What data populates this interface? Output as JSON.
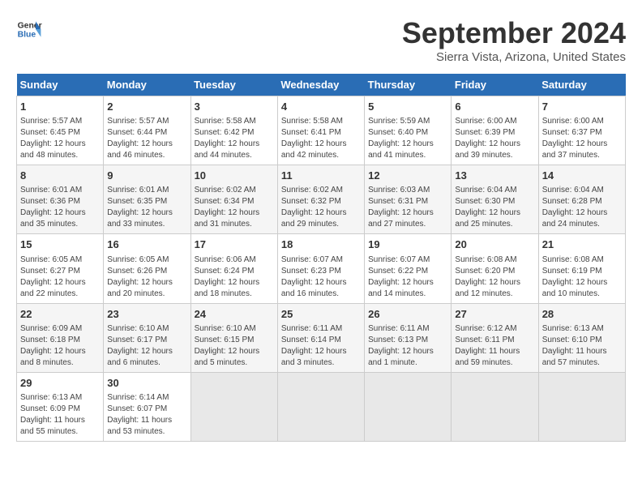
{
  "header": {
    "logo_line1": "General",
    "logo_line2": "Blue",
    "month_title": "September 2024",
    "location": "Sierra Vista, Arizona, United States"
  },
  "days_of_week": [
    "Sunday",
    "Monday",
    "Tuesday",
    "Wednesday",
    "Thursday",
    "Friday",
    "Saturday"
  ],
  "weeks": [
    [
      {
        "day": "1",
        "info": "Sunrise: 5:57 AM\nSunset: 6:45 PM\nDaylight: 12 hours\nand 48 minutes."
      },
      {
        "day": "2",
        "info": "Sunrise: 5:57 AM\nSunset: 6:44 PM\nDaylight: 12 hours\nand 46 minutes."
      },
      {
        "day": "3",
        "info": "Sunrise: 5:58 AM\nSunset: 6:42 PM\nDaylight: 12 hours\nand 44 minutes."
      },
      {
        "day": "4",
        "info": "Sunrise: 5:58 AM\nSunset: 6:41 PM\nDaylight: 12 hours\nand 42 minutes."
      },
      {
        "day": "5",
        "info": "Sunrise: 5:59 AM\nSunset: 6:40 PM\nDaylight: 12 hours\nand 41 minutes."
      },
      {
        "day": "6",
        "info": "Sunrise: 6:00 AM\nSunset: 6:39 PM\nDaylight: 12 hours\nand 39 minutes."
      },
      {
        "day": "7",
        "info": "Sunrise: 6:00 AM\nSunset: 6:37 PM\nDaylight: 12 hours\nand 37 minutes."
      }
    ],
    [
      {
        "day": "8",
        "info": "Sunrise: 6:01 AM\nSunset: 6:36 PM\nDaylight: 12 hours\nand 35 minutes."
      },
      {
        "day": "9",
        "info": "Sunrise: 6:01 AM\nSunset: 6:35 PM\nDaylight: 12 hours\nand 33 minutes."
      },
      {
        "day": "10",
        "info": "Sunrise: 6:02 AM\nSunset: 6:34 PM\nDaylight: 12 hours\nand 31 minutes."
      },
      {
        "day": "11",
        "info": "Sunrise: 6:02 AM\nSunset: 6:32 PM\nDaylight: 12 hours\nand 29 minutes."
      },
      {
        "day": "12",
        "info": "Sunrise: 6:03 AM\nSunset: 6:31 PM\nDaylight: 12 hours\nand 27 minutes."
      },
      {
        "day": "13",
        "info": "Sunrise: 6:04 AM\nSunset: 6:30 PM\nDaylight: 12 hours\nand 25 minutes."
      },
      {
        "day": "14",
        "info": "Sunrise: 6:04 AM\nSunset: 6:28 PM\nDaylight: 12 hours\nand 24 minutes."
      }
    ],
    [
      {
        "day": "15",
        "info": "Sunrise: 6:05 AM\nSunset: 6:27 PM\nDaylight: 12 hours\nand 22 minutes."
      },
      {
        "day": "16",
        "info": "Sunrise: 6:05 AM\nSunset: 6:26 PM\nDaylight: 12 hours\nand 20 minutes."
      },
      {
        "day": "17",
        "info": "Sunrise: 6:06 AM\nSunset: 6:24 PM\nDaylight: 12 hours\nand 18 minutes."
      },
      {
        "day": "18",
        "info": "Sunrise: 6:07 AM\nSunset: 6:23 PM\nDaylight: 12 hours\nand 16 minutes."
      },
      {
        "day": "19",
        "info": "Sunrise: 6:07 AM\nSunset: 6:22 PM\nDaylight: 12 hours\nand 14 minutes."
      },
      {
        "day": "20",
        "info": "Sunrise: 6:08 AM\nSunset: 6:20 PM\nDaylight: 12 hours\nand 12 minutes."
      },
      {
        "day": "21",
        "info": "Sunrise: 6:08 AM\nSunset: 6:19 PM\nDaylight: 12 hours\nand 10 minutes."
      }
    ],
    [
      {
        "day": "22",
        "info": "Sunrise: 6:09 AM\nSunset: 6:18 PM\nDaylight: 12 hours\nand 8 minutes."
      },
      {
        "day": "23",
        "info": "Sunrise: 6:10 AM\nSunset: 6:17 PM\nDaylight: 12 hours\nand 6 minutes."
      },
      {
        "day": "24",
        "info": "Sunrise: 6:10 AM\nSunset: 6:15 PM\nDaylight: 12 hours\nand 5 minutes."
      },
      {
        "day": "25",
        "info": "Sunrise: 6:11 AM\nSunset: 6:14 PM\nDaylight: 12 hours\nand 3 minutes."
      },
      {
        "day": "26",
        "info": "Sunrise: 6:11 AM\nSunset: 6:13 PM\nDaylight: 12 hours\nand 1 minute."
      },
      {
        "day": "27",
        "info": "Sunrise: 6:12 AM\nSunset: 6:11 PM\nDaylight: 11 hours\nand 59 minutes."
      },
      {
        "day": "28",
        "info": "Sunrise: 6:13 AM\nSunset: 6:10 PM\nDaylight: 11 hours\nand 57 minutes."
      }
    ],
    [
      {
        "day": "29",
        "info": "Sunrise: 6:13 AM\nSunset: 6:09 PM\nDaylight: 11 hours\nand 55 minutes."
      },
      {
        "day": "30",
        "info": "Sunrise: 6:14 AM\nSunset: 6:07 PM\nDaylight: 11 hours\nand 53 minutes."
      },
      {
        "day": "",
        "info": ""
      },
      {
        "day": "",
        "info": ""
      },
      {
        "day": "",
        "info": ""
      },
      {
        "day": "",
        "info": ""
      },
      {
        "day": "",
        "info": ""
      }
    ]
  ]
}
